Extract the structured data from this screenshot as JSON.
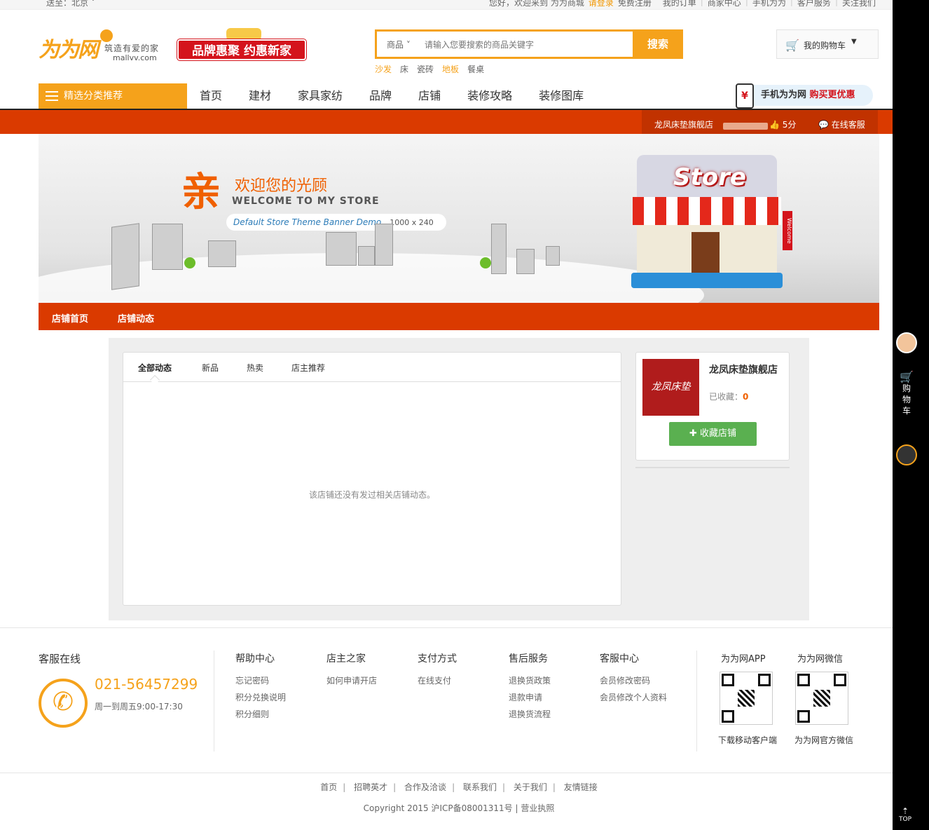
{
  "topbar": {
    "location": "送至：北京",
    "welcome": "您好，欢迎来到 为为商城",
    "login": "请登录",
    "register": "免费注册",
    "my_orders": "我的订单",
    "merchant_center": "商家中心",
    "mobile": "手机为为",
    "customer_service": "客户服务",
    "follow_us": "关注我们"
  },
  "header": {
    "logo_text": "为为网",
    "slogan": "筑造有爱的家",
    "url": "mallvv.com",
    "promo": "品牌惠聚 约惠新家",
    "search_category": "商品",
    "search_placeholder": "请输入您要搜索的商品关键字",
    "search_button": "搜索",
    "hot_words": [
      "沙发",
      "床",
      "瓷砖",
      "地板",
      "餐桌"
    ],
    "cart_label": "我的购物车"
  },
  "nav": {
    "category_button": "精选分类推荐",
    "items": [
      "首页",
      "建材",
      "家具家纺",
      "品牌",
      "店铺",
      "装修攻略",
      "装修图库"
    ],
    "mobile_promo_a": "手机为为网",
    "mobile_promo_b": "购买更优惠"
  },
  "storebar": {
    "store_name": "龙凤床垫旗舰店",
    "score": "5分",
    "online_service": "在线客服"
  },
  "banner": {
    "qin": "亲",
    "welcome": "欢迎您的光顾",
    "english": "WELCOME TO MY STORE",
    "demo": "Default Store Theme Banner Demo",
    "size": "1000 x 240",
    "store_sign": "Store",
    "welcome_flag": "Welcome"
  },
  "store_nav": {
    "home": "店铺首页",
    "news": "店铺动态"
  },
  "feed": {
    "tabs": [
      "全部动态",
      "新品",
      "热卖",
      "店主推荐"
    ],
    "empty_message": "该店铺还没有发过相关店铺动态。"
  },
  "store_card": {
    "logo_text": "龙凤床垫",
    "name": "龙凤床垫旗舰店",
    "favorited_label": "已收藏：",
    "favorited_count": "0",
    "favorite_button": "收藏店铺"
  },
  "footer": {
    "service_title": "客服在线",
    "phone": "021-56457299",
    "hours": "周一到周五9:00-17:30",
    "columns": [
      {
        "title": "帮助中心",
        "items": [
          "忘记密码",
          "积分兑换说明",
          "积分细则"
        ]
      },
      {
        "title": "店主之家",
        "items": [
          "如何申请开店"
        ]
      },
      {
        "title": "支付方式",
        "items": [
          "在线支付"
        ]
      },
      {
        "title": "售后服务",
        "items": [
          "退换货政策",
          "退款申请",
          "退换货流程"
        ]
      },
      {
        "title": "客服中心",
        "items": [
          "会员修改密码",
          "会员修改个人资料"
        ]
      }
    ],
    "app_title": "为为网APP",
    "app_caption": "下载移动客户端",
    "wechat_title": "为为网微信",
    "wechat_caption": "为为网官方微信",
    "links": [
      "首页",
      "招聘英才",
      "合作及洽谈",
      "联系我们",
      "关于我们",
      "友情链接"
    ],
    "copyright": "Copyright 2015 沪ICP备08001311号 | 营业执照"
  },
  "sidebar": {
    "cart_label": "购物车",
    "top_label": "TOP"
  },
  "colors": {
    "brand_orange": "#f5a21b",
    "store_red": "#da3a00",
    "favorite_green": "#5ab050"
  }
}
